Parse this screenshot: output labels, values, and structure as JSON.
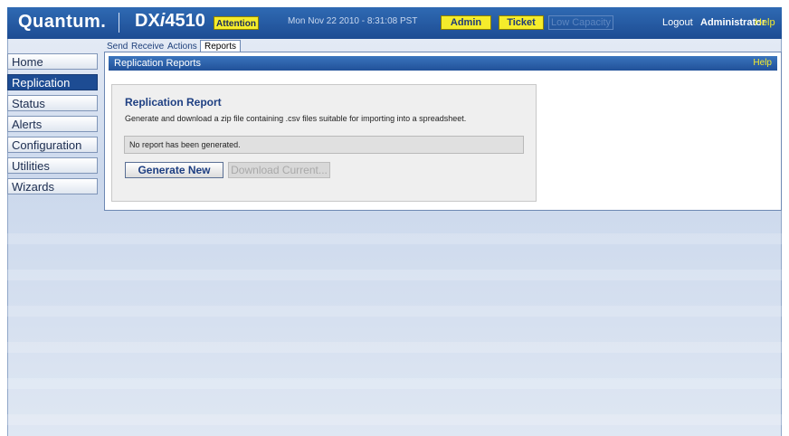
{
  "header": {
    "logo": "Quantum.",
    "product_prefix": "DX",
    "product_i": "i",
    "product_suffix": "4510",
    "attention": "Attention",
    "datetime": "Mon Nov 22 2010 - 8:31:08 PST",
    "admin": "Admin",
    "ticket": "Ticket",
    "low_capacity": "Low Capacity",
    "logout": "Logout",
    "user": "Administrator",
    "help": "Help"
  },
  "subtabs": [
    "Send",
    "Receive",
    "Actions",
    "Reports"
  ],
  "nav": [
    "Home",
    "Replication",
    "Status",
    "Alerts",
    "Configuration",
    "Utilities",
    "Wizards"
  ],
  "main": {
    "title": "Replication Reports",
    "help": "Help",
    "report": {
      "title": "Replication Report",
      "description": "Generate and download a zip file containing .csv files suitable for importing into a spreadsheet.",
      "status": "No report has been generated.",
      "generate_button": "Generate New",
      "download_button": "Download Current..."
    }
  },
  "colors": {
    "header_blue": "#1d4c93",
    "accent_yellow": "#f5ec2b"
  }
}
